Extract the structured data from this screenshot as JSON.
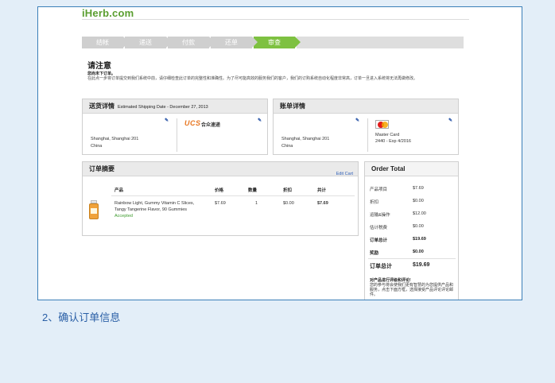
{
  "logo": "iHerb.com",
  "steps": [
    {
      "label": "结帐",
      "active": false
    },
    {
      "label": "递送",
      "active": false
    },
    {
      "label": "付款",
      "active": false
    },
    {
      "label": "还单",
      "active": false
    },
    {
      "label": "审查",
      "active": true
    }
  ],
  "notice": {
    "title": "请注意",
    "subtitle": "您尚未下订单。",
    "body": "在此点一步将订单提交到我们系统中前，请仔细检查此订单的完整性和准确性。为了尽可能高效的服务我们的客户，我们的订购系统自动化程度非常高，订单一旦进入系统将无法再做修改。"
  },
  "shipping": {
    "heading": "送货详情",
    "estimated": "Estimated Shipping Date - December 27, 2013",
    "address_line1": "Shanghai, Shanghai 201",
    "address_line2": "China",
    "carrier_logo": "UCS",
    "carrier_name": "合众速递"
  },
  "billing": {
    "heading": "账单详情",
    "address_line1": "Shanghai, Shanghai 201",
    "address_line2": "China",
    "card_type": "Master Card",
    "card_detail": "2440 - Exp 4/2016"
  },
  "order_summary": {
    "heading": "订单摘要",
    "edit_cart": "Edit Cart",
    "columns": {
      "product": "产品",
      "price": "价格",
      "qty": "数量",
      "discount": "折扣",
      "total": "共计"
    },
    "items": [
      {
        "name_line1": "Rainbow Light, Gummy Vitamin C Slices,",
        "name_line2": "Tangy Tangerine Flavor, 90 Gummies",
        "status": "Accepted",
        "price": "$7.69",
        "qty": "1",
        "discount": "$0.00",
        "total": "$7.69"
      }
    ]
  },
  "order_total": {
    "heading": "Order Total",
    "rows": [
      {
        "label": "产品项目",
        "value": "$7.69",
        "style": "normal"
      },
      {
        "label": "折扣",
        "value": "$0.00",
        "style": "green"
      },
      {
        "label": "运输&操作",
        "value": "$12.00",
        "style": "normal"
      },
      {
        "label": "估计税费",
        "value": "$0.00",
        "style": "normal"
      },
      {
        "label": "订单总计",
        "value": "$19.69",
        "style": "bold"
      },
      {
        "label": "奖励",
        "value": "$0.00",
        "style": "greenbold"
      },
      {
        "label": "订单总计",
        "value": "$19.69",
        "style": "big"
      }
    ],
    "review_title": "对产品进行评级和评论!",
    "review_body": "您的参与将会使我们更有智慧的为您提供产品和服务，点击下面方框，选择接受产品评论评论邮件。"
  },
  "caption": "2、确认订单信息",
  "colors": {
    "accent_green": "#7ec141",
    "link_blue": "#3060b8",
    "frame_blue": "#3b7fb8"
  }
}
